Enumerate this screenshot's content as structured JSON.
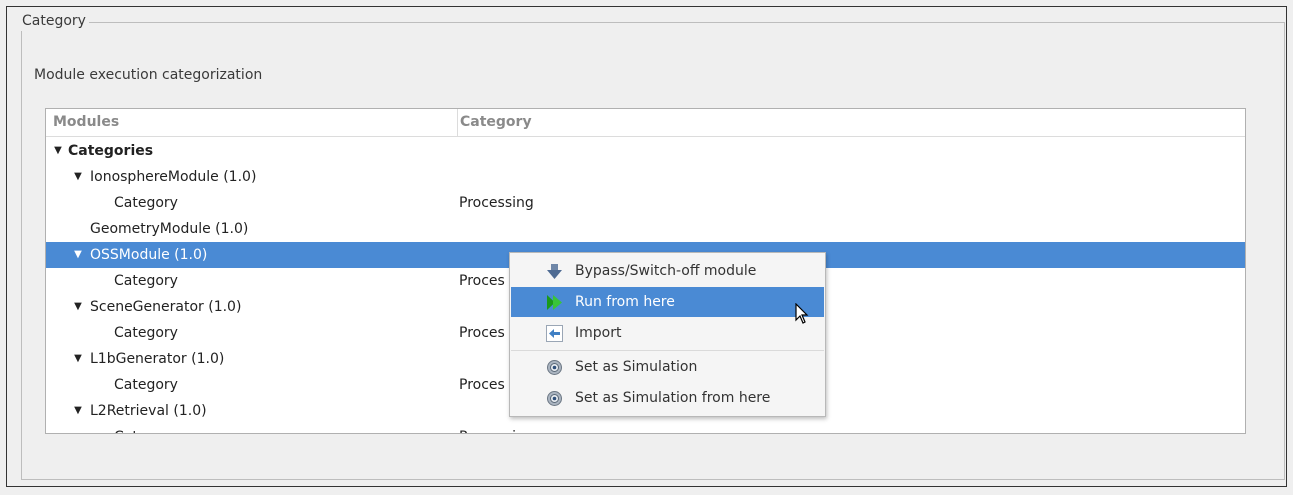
{
  "groupbox": {
    "title": "Category"
  },
  "subtitle": "Module execution categorization",
  "tree": {
    "columns": [
      "Modules",
      "Category"
    ],
    "rows": [
      {
        "label": "Categories",
        "category": "",
        "expanded": true,
        "selected": false
      },
      {
        "label": "IonosphereModule (1.0)",
        "category": "",
        "expanded": true,
        "selected": false
      },
      {
        "label": "Category",
        "category": "Processing",
        "selected": false
      },
      {
        "label": "GeometryModule (1.0)",
        "category": "",
        "selected": false
      },
      {
        "label": "OSSModule (1.0)",
        "category": "",
        "expanded": true,
        "selected": true
      },
      {
        "label": "Category",
        "category": "Proces",
        "selected": false
      },
      {
        "label": "SceneGenerator (1.0)",
        "category": "",
        "expanded": true,
        "selected": false
      },
      {
        "label": "Category",
        "category": "Proces",
        "selected": false
      },
      {
        "label": "L1bGenerator (1.0)",
        "category": "",
        "expanded": true,
        "selected": false
      },
      {
        "label": "Category",
        "category": "Proces",
        "selected": false
      },
      {
        "label": "L2Retrieval (1.0)",
        "category": "",
        "expanded": true,
        "selected": false
      },
      {
        "label": "Category",
        "category": "Processing",
        "selected": false
      }
    ]
  },
  "context_menu": {
    "items": [
      {
        "label": "Bypass/Switch-off module",
        "icon": "bypass-down-arrow-icon",
        "highlighted": false
      },
      {
        "label": "Run from here",
        "icon": "run-play-icon",
        "highlighted": true
      },
      {
        "label": "Import",
        "icon": "import-arrow-icon",
        "highlighted": false
      },
      {
        "label": "Set as Simulation",
        "icon": "gear-icon",
        "highlighted": false
      },
      {
        "label": "Set as Simulation from here",
        "icon": "gear-icon",
        "highlighted": false
      }
    ]
  },
  "colors": {
    "selection": "#4a8ad4",
    "menu_bg": "#f5f5f5",
    "window_bg": "#efefef"
  }
}
